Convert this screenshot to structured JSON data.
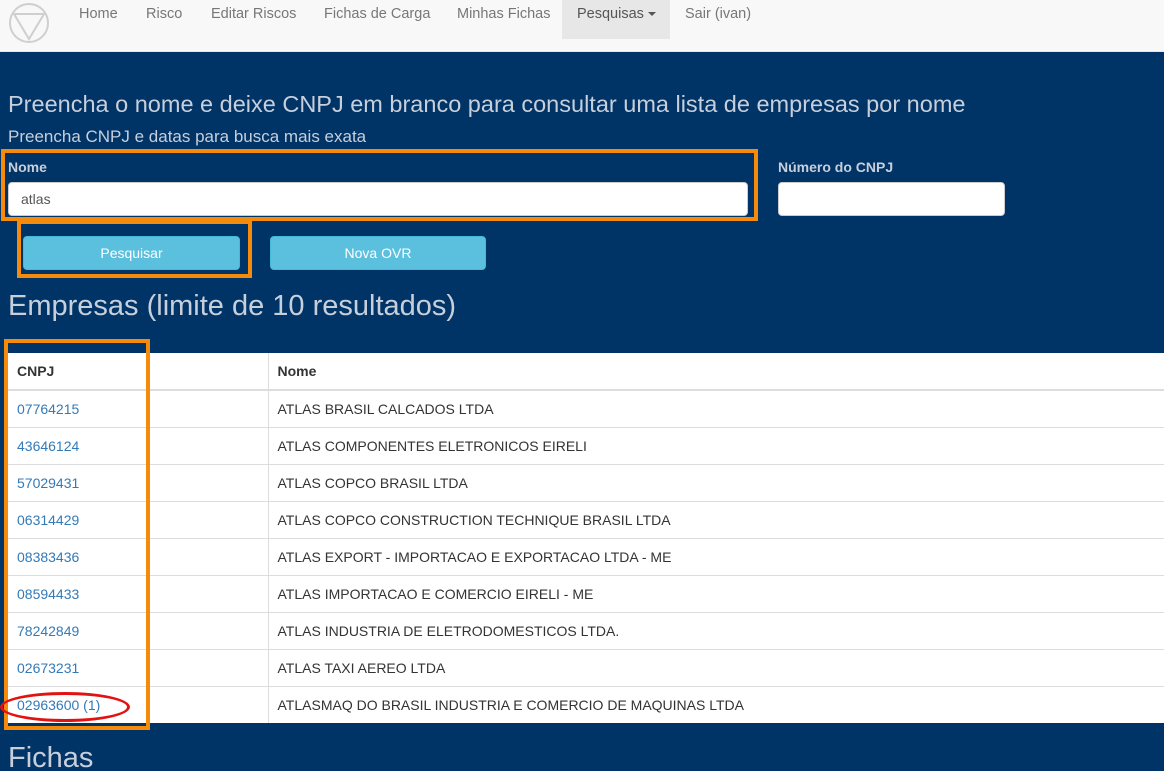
{
  "nav": {
    "logo_icon": "triangle-circle-logo-icon",
    "items": [
      "Home",
      "Risco",
      "Editar Riscos",
      "Fichas de Carga",
      "Minhas Fichas",
      "Pesquisas",
      "Sair (ivan)"
    ],
    "active_item": "Pesquisas"
  },
  "instructions": {
    "line1": "Preencha o nome e deixe CNPJ em branco para consultar uma lista de empresas por nome",
    "line2": "Preencha CNPJ e datas para busca mais exata"
  },
  "form": {
    "nome_label": "Nome",
    "nome_value": "atlas",
    "cnpj_label": "Número do CNPJ",
    "cnpj_value": "",
    "search_button": "Pesquisar",
    "new_ovr_button": "Nova OVR"
  },
  "results": {
    "title": "Empresas (limite de 10 resultados)",
    "headers": [
      "CNPJ",
      "Nome"
    ],
    "rows": [
      {
        "cnpj": "07764215",
        "nome": "ATLAS BRASIL CALCADOS LTDA"
      },
      {
        "cnpj": "43646124",
        "nome": "ATLAS COMPONENTES ELETRONICOS EIRELI"
      },
      {
        "cnpj": "57029431",
        "nome": "ATLAS COPCO BRASIL LTDA"
      },
      {
        "cnpj": "06314429",
        "nome": "ATLAS COPCO CONSTRUCTION TECHNIQUE BRASIL LTDA"
      },
      {
        "cnpj": "08383436",
        "nome": "ATLAS EXPORT - IMPORTACAO E EXPORTACAO LTDA - ME"
      },
      {
        "cnpj": "08594433",
        "nome": "ATLAS IMPORTACAO E COMERCIO EIRELI - ME"
      },
      {
        "cnpj": "78242849",
        "nome": "ATLAS INDUSTRIA DE ELETRODOMESTICOS LTDA."
      },
      {
        "cnpj": "02673231",
        "nome": "ATLAS TAXI AEREO LTDA"
      },
      {
        "cnpj": "02963600 (1)",
        "nome": "ATLASMAQ DO BRASIL INDUSTRIA E COMERCIO DE MAQUINAS LTDA"
      }
    ]
  },
  "fichas": {
    "title": "Fichas"
  },
  "colors": {
    "background": "#003366",
    "highlight_orange": "#f58a0b",
    "highlight_red": "#e31212",
    "button": "#5bc0de",
    "link": "#337ab7"
  }
}
